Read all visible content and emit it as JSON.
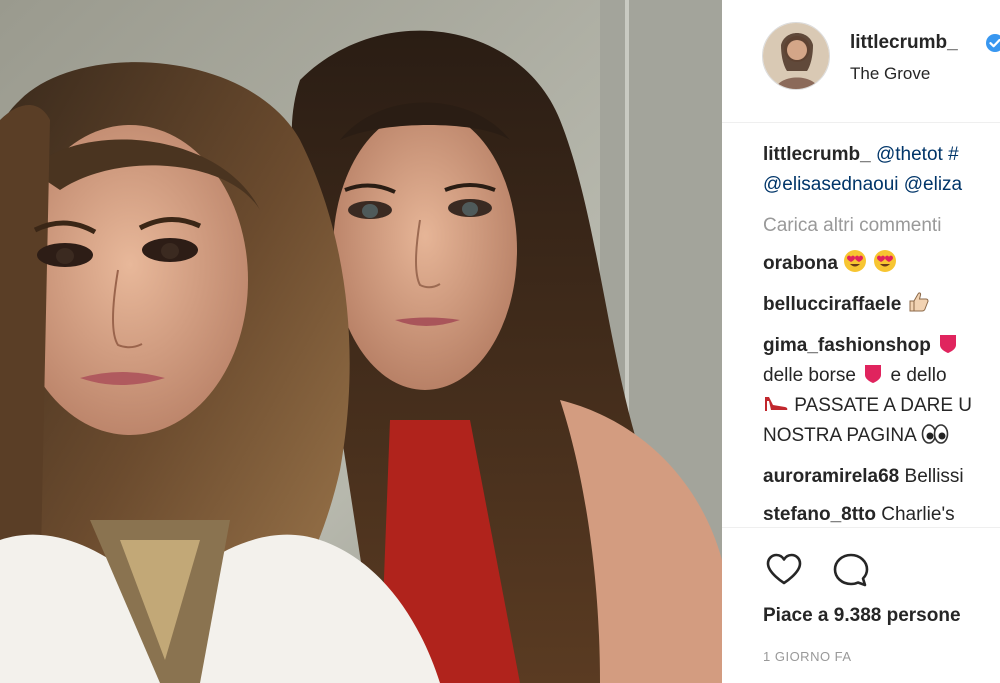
{
  "post": {
    "photo_alt": "selfie",
    "author": {
      "username": "littlecrumb_",
      "location": "The Grove"
    },
    "caption": {
      "username": "littlecrumb_",
      "text_line1": "@thetot #",
      "text_line2": "@elisasednaoui @eliza"
    },
    "load_more": "Carica altri commenti",
    "comments": [
      {
        "username": "orabona",
        "text": ""
      },
      {
        "username": "bellucciraffaele",
        "text": ""
      },
      {
        "username": "gima_fashionshop",
        "line2": "delle borse",
        "line2b": "e dello",
        "line3": "PASSATE A DARE U",
        "line4": "NOSTRA PAGINA"
      },
      {
        "username": "auroramirela68",
        "text": "Bellissi"
      },
      {
        "username": "stefano_8tto",
        "text": "Charlie's"
      }
    ],
    "likes": "Piace a 9.388 persone",
    "time": "1 GIORNO FA",
    "colors": {
      "text": "#262626",
      "muted": "#999999",
      "verified": "#3897f0",
      "link": "#003569"
    }
  }
}
